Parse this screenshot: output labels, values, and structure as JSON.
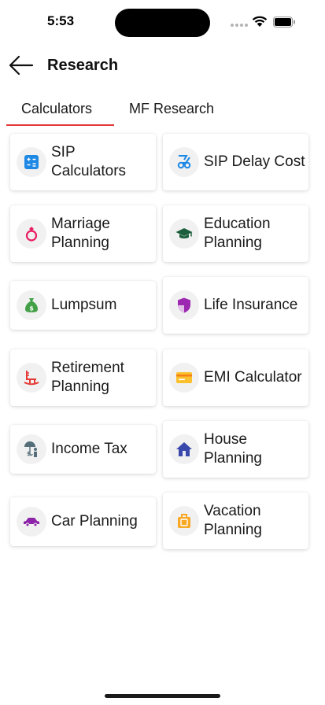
{
  "status_bar": {
    "time": "5:53"
  },
  "header": {
    "title": "Research",
    "back_icon": "arrow-left-icon"
  },
  "tabs": [
    {
      "label": "Calculators",
      "active": true
    },
    {
      "label": "MF Research",
      "active": false
    }
  ],
  "accent_color": "#e23a3a",
  "calculators": [
    {
      "label": "SIP Calculators",
      "icon": "calculator-icon",
      "color": "#1e88e5"
    },
    {
      "label": "SIP Delay Cost",
      "icon": "sip-delay-icon",
      "color": "#1e88e5"
    },
    {
      "label": "Marriage Planning",
      "icon": "ring-icon",
      "color": "#e91e63"
    },
    {
      "label": "Education Planning",
      "icon": "graduation-cap-icon",
      "color": "#1b5e3b"
    },
    {
      "label": "Lumpsum",
      "icon": "money-bag-icon",
      "color": "#43a047"
    },
    {
      "label": "Life Insurance",
      "icon": "shield-icon",
      "color": "#9c27b0"
    },
    {
      "label": "Retirement Planning",
      "icon": "rocking-chair-icon",
      "color": "#e53935"
    },
    {
      "label": "EMI Calculator",
      "icon": "card-icon",
      "color": "#fbc02d"
    },
    {
      "label": "Income Tax",
      "icon": "person-umbrella-icon",
      "color": "#546e7a"
    },
    {
      "label": "House Planning",
      "icon": "house-icon",
      "color": "#3949ab"
    },
    {
      "label": "Car Planning",
      "icon": "car-icon",
      "color": "#8e24aa"
    },
    {
      "label": "Vacation Planning",
      "icon": "suitcase-icon",
      "color": "#f9a825"
    }
  ]
}
